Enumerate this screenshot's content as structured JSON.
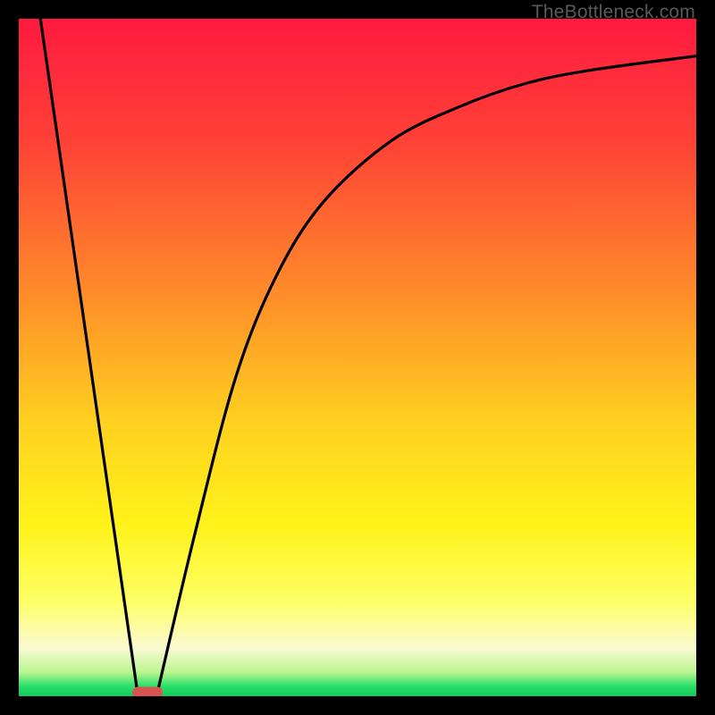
{
  "watermark": "TheBottleneck.com",
  "chart_data": {
    "type": "line",
    "title": "",
    "xlabel": "",
    "ylabel": "",
    "xlim": [
      0,
      1
    ],
    "ylim": [
      0,
      1
    ],
    "gradient_stops": [
      {
        "offset": 0.0,
        "color": "#ff1a40"
      },
      {
        "offset": 0.18,
        "color": "#ff4136"
      },
      {
        "offset": 0.4,
        "color": "#ff8a2a"
      },
      {
        "offset": 0.6,
        "color": "#ffd21f"
      },
      {
        "offset": 0.75,
        "color": "#fff31a"
      },
      {
        "offset": 0.86,
        "color": "#fdff66"
      },
      {
        "offset": 0.93,
        "color": "#fafad2"
      },
      {
        "offset": 0.965,
        "color": "#b8f58e"
      },
      {
        "offset": 0.985,
        "color": "#29e06a"
      },
      {
        "offset": 1.0,
        "color": "#14c95a"
      }
    ],
    "curve_left": {
      "description": "steep linear descent from top-left to trough",
      "x": [
        0.032,
        0.175
      ],
      "y": [
        1.0,
        0.007
      ]
    },
    "curve_right": {
      "description": "rise from trough then saturating toward upper right",
      "x": [
        0.205,
        0.26,
        0.32,
        0.38,
        0.45,
        0.55,
        0.65,
        0.75,
        0.85,
        1.0
      ],
      "y": [
        0.007,
        0.24,
        0.47,
        0.62,
        0.73,
        0.82,
        0.87,
        0.905,
        0.925,
        0.945
      ]
    },
    "trough_marker": {
      "x_center": 0.19,
      "y": 0.006,
      "width": 0.045,
      "color": "#d9544f"
    }
  }
}
